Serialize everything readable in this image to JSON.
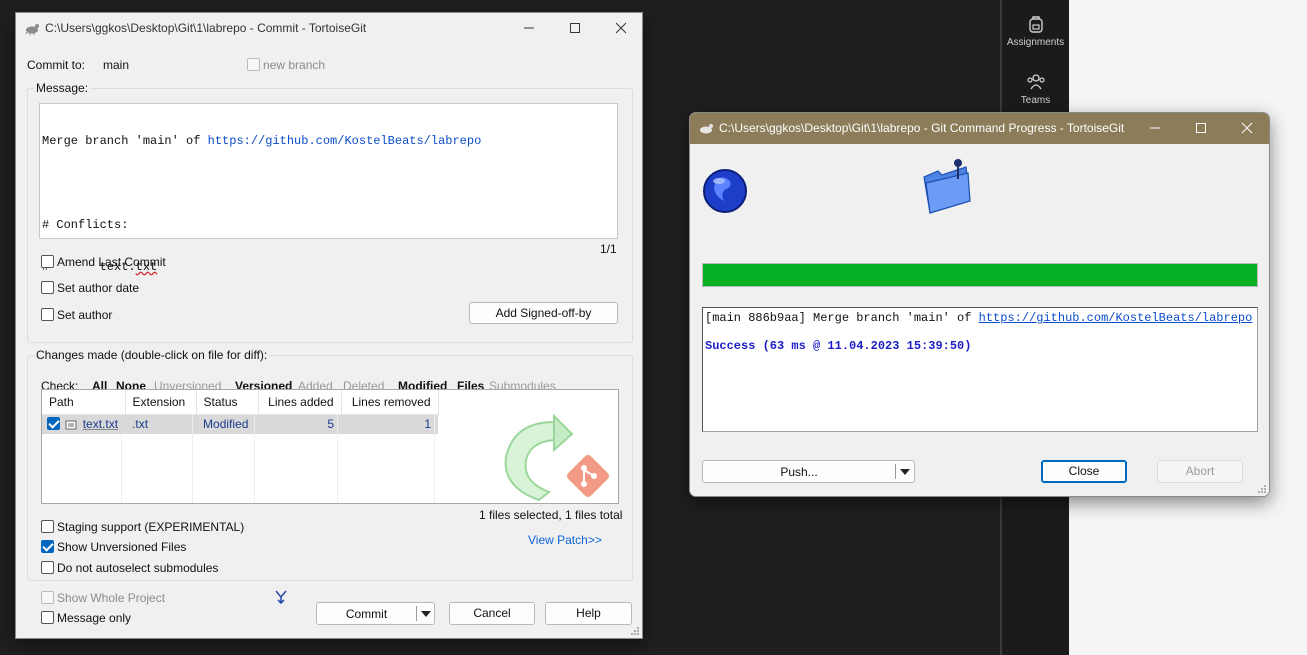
{
  "teams_rail": {
    "items": [
      {
        "label": "Assignments",
        "icon": "backpack-icon"
      },
      {
        "label": "Teams",
        "icon": "people-icon"
      }
    ]
  },
  "commit_window": {
    "title": "C:\\Users\\ggkos\\Desktop\\Git\\1\\labrepo - Commit - TortoiseGit",
    "commit_to_label": "Commit to:",
    "branch": "main",
    "new_branch_label": "new branch",
    "message_label": "Message:",
    "message_lines": {
      "line1_prefix": "Merge branch 'main' of ",
      "line1_url": "https://github.com/KostelBeats/labrepo",
      "line3": "# Conflicts:",
      "line4_prefix": "#       text.",
      "line4_ext": "txt"
    },
    "page_indicator": "1/1",
    "amend_label": "Amend Last Commit",
    "set_author_date_label": "Set author date",
    "set_author_label": "Set author",
    "signed_off_button": "Add Signed-off-by",
    "changes_label": "Changes made (double-click on file for diff):",
    "check_label": "Check:",
    "filters": {
      "all": "All",
      "none": "None",
      "unversioned": "Unversioned",
      "versioned": "Versioned",
      "added": "Added",
      "deleted": "Deleted",
      "modified": "Modified",
      "files": "Files",
      "submodules": "Submodules"
    },
    "columns": {
      "path": "Path",
      "extension": "Extension",
      "status": "Status",
      "lines_added": "Lines added",
      "lines_removed": "Lines removed"
    },
    "file_row": {
      "path": "text.txt",
      "extension": ".txt",
      "status": "Modified",
      "lines_added": "5",
      "lines_removed": "1",
      "checked": true
    },
    "selection_summary": "1 files selected, 1 files total",
    "staging_label": "Staging support (EXPERIMENTAL)",
    "show_unversioned_label": "Show Unversioned Files",
    "no_autoselect_label": "Do not autoselect submodules",
    "view_patch_link": "View Patch>>",
    "show_whole_project_label": "Show Whole Project",
    "message_only_label": "Message only",
    "commit_button": "Commit",
    "cancel_button": "Cancel",
    "help_button": "Help"
  },
  "progress_window": {
    "title": "C:\\Users\\ggkos\\Desktop\\Git\\1\\labrepo - Git Command Progress - TortoiseGit",
    "progress": 1.0,
    "progress_color": "#06b025",
    "log_line1_prefix": "[main 886b9aa] Merge branch 'main' of ",
    "log_line1_url": "https://github.com/KostelBeats/labrepo",
    "log_success": "Success (63 ms @ 11.04.2023 15:39:50)",
    "push_button": "Push...",
    "close_button": "Close",
    "abort_button": "Abort"
  },
  "colors": {
    "accent": "#0067c0",
    "link": "#0b4dcc",
    "success_text": "#1c1cc8",
    "progress_green": "#06b025"
  }
}
